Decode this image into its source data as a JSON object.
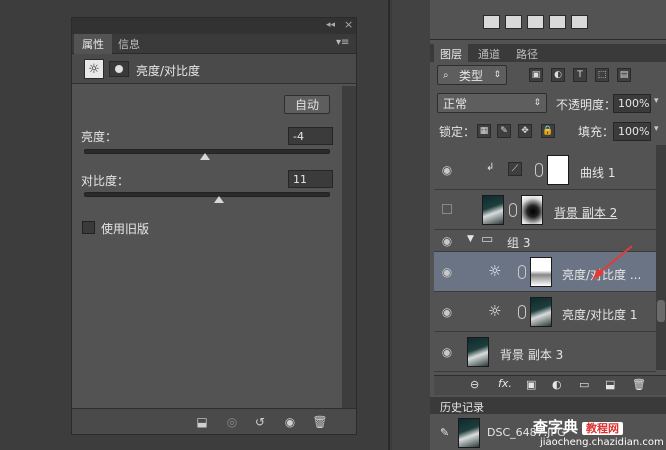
{
  "properties_panel": {
    "tabs": [
      {
        "label": "属性",
        "active": true
      },
      {
        "label": "信息",
        "active": false
      }
    ],
    "adjustment_title": "亮度/对比度",
    "auto_button": "自动",
    "brightness": {
      "label": "亮度：",
      "value": "-4",
      "slider_fraction": 0.49
    },
    "contrast": {
      "label": "对比度：",
      "value": "11",
      "slider_fraction": 0.55
    },
    "legacy_checkbox": {
      "label": "使用旧版",
      "checked": false
    }
  },
  "layers_panel": {
    "tabs": [
      {
        "label": "图层",
        "active": true
      },
      {
        "label": "通道",
        "active": false
      },
      {
        "label": "路径",
        "active": false
      }
    ],
    "filter_kind": "类型",
    "blend_mode": "正常",
    "opacity_label": "不透明度：",
    "opacity_value": "100%",
    "lock_label": "锁定：",
    "fill_label": "填充：",
    "fill_value": "100%",
    "layers": [
      {
        "name": "曲线 1",
        "visible": true,
        "selected": false
      },
      {
        "name": "背景 副本 2",
        "visible": false,
        "selected": false
      },
      {
        "name": "组 3",
        "visible": true,
        "selected": false
      },
      {
        "name": "亮度/对比度 ...",
        "visible": true,
        "selected": true
      },
      {
        "name": "亮度/对比度 1",
        "visible": true,
        "selected": false
      },
      {
        "name": "背景 副本 3",
        "visible": true,
        "selected": false
      }
    ]
  },
  "history_panel": {
    "tab_label": "历史记录",
    "item": "DSC_6487.JPG"
  },
  "watermark": {
    "text": "查字典",
    "badge": "教程网",
    "url": "jiaocheng.chazidian.com"
  },
  "colors": {
    "panel": "#535353",
    "dark": "#3a3a3a",
    "selected_row": "#6b7484",
    "arrow": "#e53935"
  }
}
